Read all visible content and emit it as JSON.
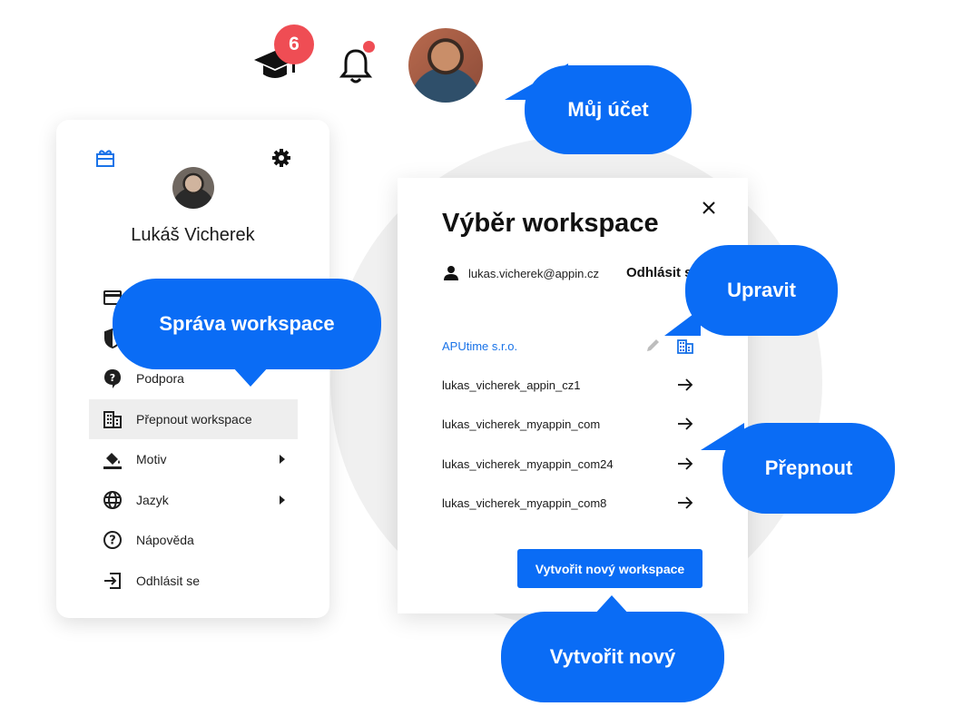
{
  "topbar": {
    "badge_count": "6",
    "icons": [
      "graduation-cap-icon",
      "bell-icon"
    ]
  },
  "menu": {
    "user_name": "Lukáš Vicherek",
    "items": [
      {
        "label": "",
        "icon": "credit-card-icon"
      },
      {
        "label": "",
        "icon": "shield-icon"
      },
      {
        "label": "Podpora",
        "icon": "help-bubble-icon"
      },
      {
        "label": "Přepnout workspace",
        "icon": "building-icon",
        "active": true
      },
      {
        "label": "Motiv",
        "icon": "paint-bucket-icon",
        "submenu": true
      },
      {
        "label": "Jazyk",
        "icon": "globe-icon",
        "submenu": true
      },
      {
        "label": "Nápověda",
        "icon": "question-circle-icon"
      },
      {
        "label": "Odhlásit se",
        "icon": "logout-icon"
      }
    ]
  },
  "dialog": {
    "title": "Výběr workspace",
    "email": "lukas.vicherek@appin.cz",
    "logout_link": "Odhlásit s",
    "workspaces": [
      {
        "name": "APUtime s.r.o.",
        "current": true
      },
      {
        "name": "lukas_vicherek_appin_cz1"
      },
      {
        "name": "lukas_vicherek_myappin_com"
      },
      {
        "name": "lukas_vicherek_myappin_com24"
      },
      {
        "name": "lukas_vicherek_myappin_com8"
      }
    ],
    "create_button": "Vytvořit nový workspace"
  },
  "callouts": {
    "account": "Můj účet",
    "workspace_management": "Správa workspace",
    "edit": "Upravit",
    "switch": "Přepnout",
    "create_new": "Vytvořit nový"
  },
  "colors": {
    "accent": "#0a6cf5",
    "badge": "#ef4d54",
    "link": "#1a73e8"
  }
}
